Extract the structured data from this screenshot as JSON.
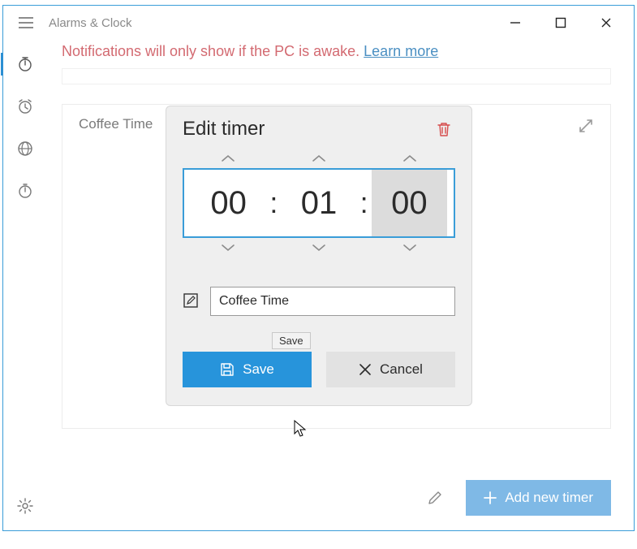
{
  "app": {
    "title": "Alarms & Clock"
  },
  "notification": {
    "text": "Notifications will only show if the PC is awake. ",
    "link": "Learn more"
  },
  "timer_card": {
    "title": "Coffee Time"
  },
  "dialog": {
    "title": "Edit timer",
    "hours": "00",
    "minutes": "01",
    "seconds": "00",
    "name": "Coffee Time",
    "save_label": "Save",
    "cancel_label": "Cancel",
    "tooltip": "Save"
  },
  "bottom": {
    "add_label": "Add new timer"
  }
}
